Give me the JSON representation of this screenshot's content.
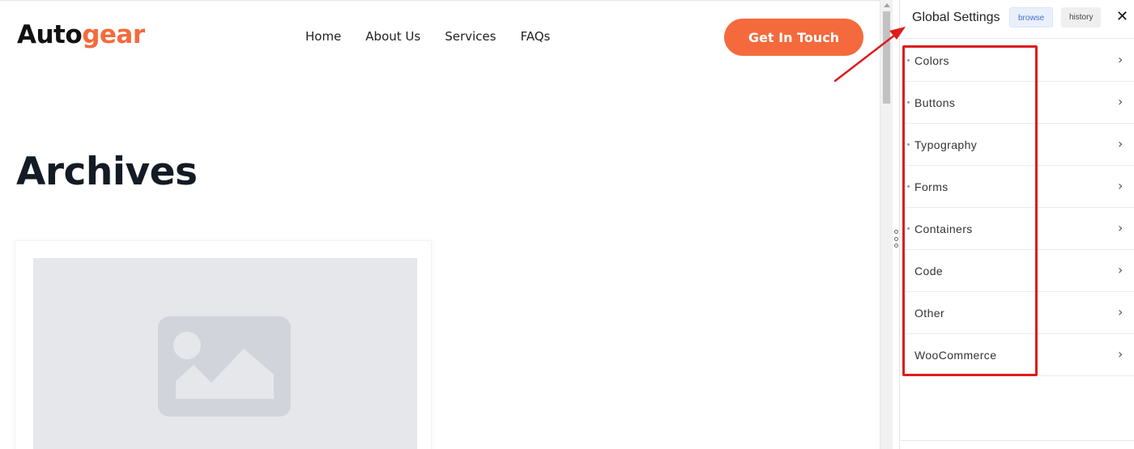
{
  "site": {
    "logo_primary": "Auto",
    "logo_accent": "gear",
    "nav": [
      "Home",
      "About Us",
      "Services",
      "FAQs"
    ],
    "cta_label": "Get In Touch",
    "page_heading": "Archives"
  },
  "panel": {
    "title": "Global Settings",
    "browse_label": "browse",
    "history_label": "history",
    "close_icon": "close-icon",
    "items": [
      {
        "label": "Colors",
        "has_dot": true
      },
      {
        "label": "Buttons",
        "has_dot": true
      },
      {
        "label": "Typography",
        "has_dot": true
      },
      {
        "label": "Forms",
        "has_dot": true
      },
      {
        "label": "Containers",
        "has_dot": true
      },
      {
        "label": "Code",
        "has_dot": false
      },
      {
        "label": "Other",
        "has_dot": false
      },
      {
        "label": "WooCommerce",
        "has_dot": false
      }
    ],
    "chevron_icon": "chevron-right-icon"
  },
  "colors": {
    "brand_accent": "#f36b3b",
    "cta_bg": "#f46a3c",
    "annotation": "#dd1c1c",
    "browse_pill_bg": "#eaf0fb",
    "browse_pill_text": "#4272c4"
  },
  "icons": {
    "image_placeholder": "image-placeholder-icon",
    "resize_handle": "drag-handle-icon"
  }
}
